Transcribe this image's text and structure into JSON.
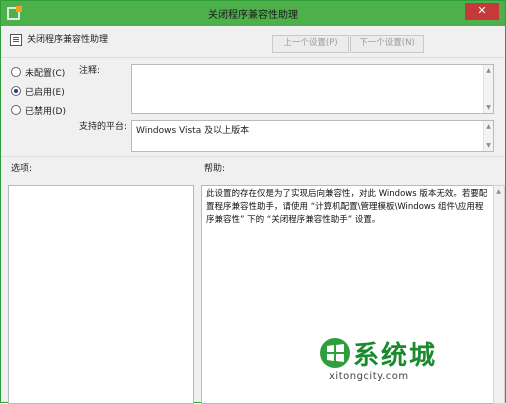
{
  "window": {
    "title": "关闭程序兼容性助理",
    "close_glyph": "✕"
  },
  "header": {
    "policy_name": "关闭程序兼容性助理",
    "prev_button": "上一个设置(P)",
    "next_button": "下一个设置(N)"
  },
  "state": {
    "options": [
      {
        "label": "未配置(C)",
        "checked": false
      },
      {
        "label": "已启用(E)",
        "checked": true
      },
      {
        "label": "已禁用(D)",
        "checked": false
      }
    ]
  },
  "comment": {
    "label": "注释:",
    "value": ""
  },
  "platform": {
    "label": "支持的平台:",
    "value": "Windows Vista 及以上版本"
  },
  "sections": {
    "options_label": "选项:",
    "help_label": "帮助:"
  },
  "help": {
    "text": "此设置的存在仅是为了实现后向兼容性，对此 Windows 版本无效。若要配置程序兼容性助手，请使用 “计算机配置\\管理模板\\Windows 组件\\应用程序兼容性” 下的 “关闭程序兼容性助手” 设置。"
  },
  "watermark": {
    "brand": "系统城",
    "url": "xitongcity.com"
  },
  "colors": {
    "titlebar": "#4db04b",
    "close": "#c7383a",
    "watermark": "#1b8a2e"
  }
}
